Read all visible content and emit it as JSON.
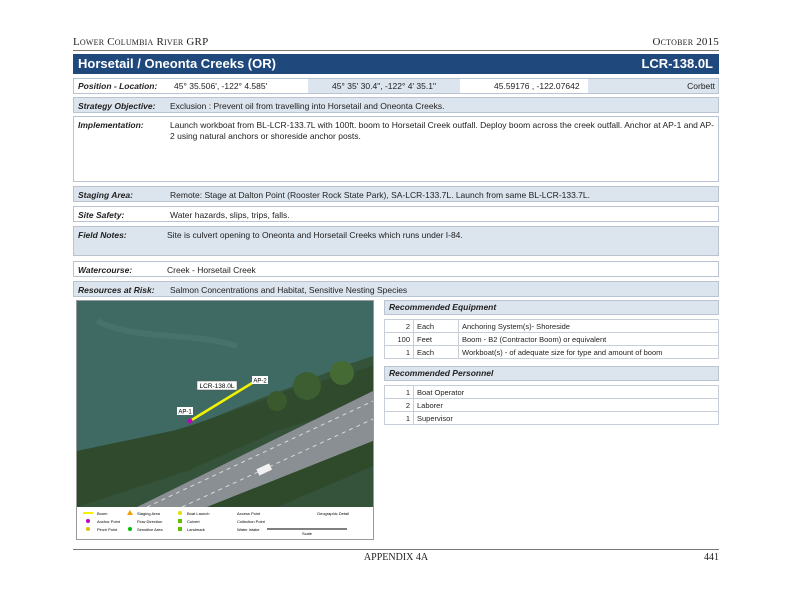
{
  "header": {
    "left": "Lower Columbia River GRP",
    "right": "October 2015"
  },
  "title": {
    "name": "Horsetail / Oneonta Creeks (OR)",
    "code": "LCR-138.0L"
  },
  "location": {
    "label": "Position - Location:",
    "dm": "45° 35.506', -122° 4.585'",
    "dms": "45° 35' 30.4\", -122° 4' 35.1\"",
    "dd": "45.59176 , -122.07642",
    "place": "Corbett"
  },
  "strategy": {
    "label": "Strategy Objective:",
    "value": "Exclusion :   Prevent oil from travelling into Horsetail and Oneonta Creeks."
  },
  "implementation": {
    "label": "Implementation:",
    "value": "Launch workboat from BL-LCR-133.7L with 100ft. boom to Horsetail Creek outfall.  Deploy boom across the creek outfall. Anchor at AP-1 and AP-2 using natural anchors or shoreside anchor posts."
  },
  "staging": {
    "label": "Staging Area:",
    "value": "Remote:  Stage at Dalton Point (Rooster Rock State Park), SA-LCR-133.7L. Launch from same BL-LCR-133.7L."
  },
  "safety": {
    "label": "Site Safety:",
    "value": "Water hazards, slips, trips, falls."
  },
  "field_notes": {
    "label": "Field Notes:",
    "value": "Site is culvert opening to Oneonta and Horsetail Creeks which runs under I-84."
  },
  "watercourse": {
    "label": "Watercourse:",
    "value": "Creek  - Horsetail Creek"
  },
  "resources": {
    "label": "Resources at Risk:",
    "value": "Salmon Concentrations and Habitat, Sensitive Nesting Species"
  },
  "map": {
    "labels": {
      "strategy": "LCR-138.0L",
      "ap1": "AP-1",
      "ap2": "AP-2"
    },
    "legend": [
      "Boom",
      "Anchor Point",
      "Pinch Point",
      "Staging Area",
      "Flow Direction",
      "Sensitive Area",
      "Boat Launch",
      "Culvert",
      "Landmark",
      "Access Point",
      "Collection Point",
      "Water Intake",
      "Scale",
      "Geographic Detail"
    ]
  },
  "equipment": {
    "title": "Recommended Equipment",
    "rows": [
      {
        "qty": "2",
        "unit": "Each",
        "item": "Anchoring System(s)- Shoreside"
      },
      {
        "qty": "100",
        "unit": "Feet",
        "item": "Boom - B2 (Contractor Boom) or equivalent"
      },
      {
        "qty": "1",
        "unit": "Each",
        "item": "Workboat(s)  - of adequate size for type and amount of boom"
      }
    ]
  },
  "personnel": {
    "title": "Recommended Personnel",
    "rows": [
      {
        "qty": "1",
        "item": "Boat Operator"
      },
      {
        "qty": "2",
        "item": "Laborer"
      },
      {
        "qty": "1",
        "item": "Supervisor"
      }
    ]
  },
  "footer": {
    "center": "APPENDIX 4A",
    "page": "441"
  },
  "colors": {
    "title_bar": "#1f497d",
    "row_shade": "#dce4ee",
    "boom": "#f2f200",
    "anchor": "#c000c0"
  }
}
